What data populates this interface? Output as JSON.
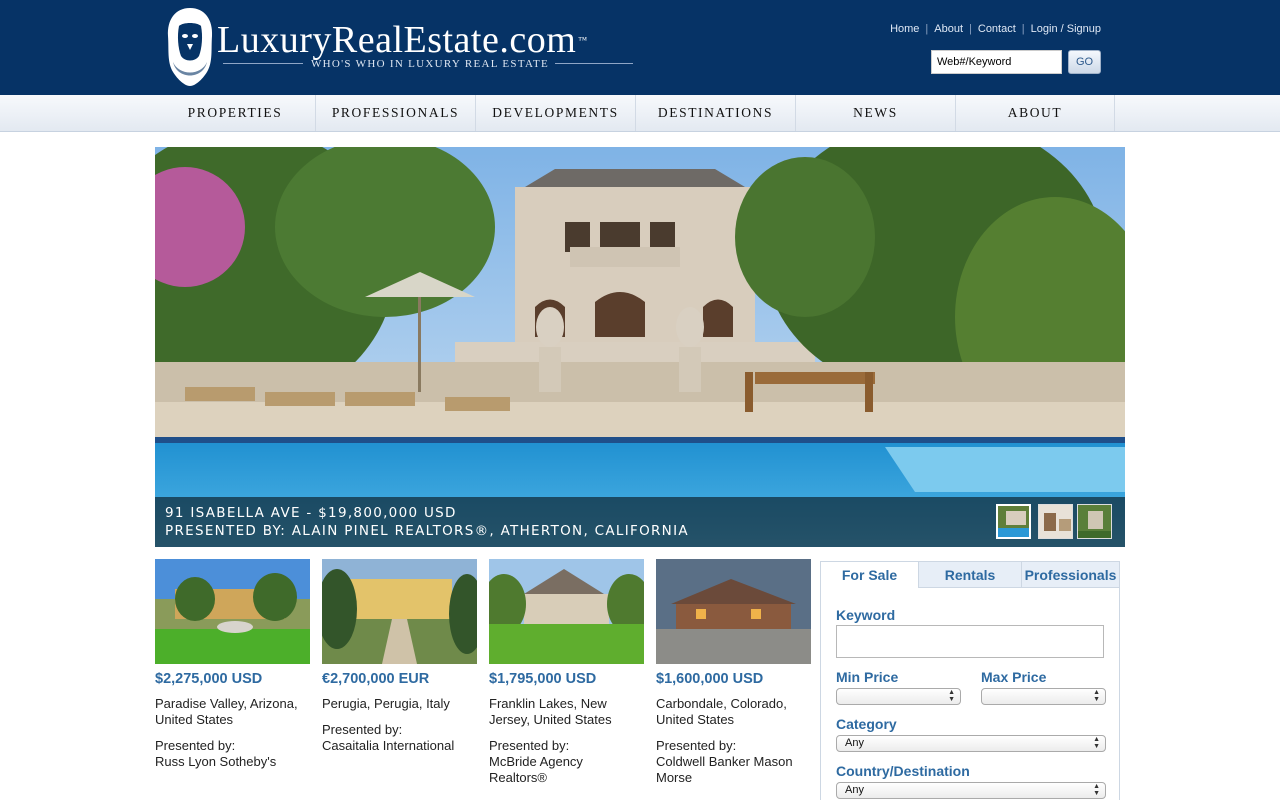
{
  "header": {
    "brand_title": "LuxuryRealEstate.com",
    "trademark": "™",
    "tagline": "WHO'S WHO IN LUXURY REAL ESTATE",
    "top_links": [
      {
        "label": "Home"
      },
      {
        "label": "About"
      },
      {
        "label": "Contact"
      },
      {
        "label": "Login / Signup"
      }
    ],
    "search_value": "Web#/Keyword",
    "go_label": "GO"
  },
  "nav": {
    "items": [
      {
        "label": "PROPERTIES"
      },
      {
        "label": "PROFESSIONALS"
      },
      {
        "label": "DEVELOPMENTS"
      },
      {
        "label": "DESTINATIONS"
      },
      {
        "label": "NEWS"
      },
      {
        "label": "ABOUT"
      }
    ]
  },
  "hero": {
    "line1": "91 ISABELLA AVE - $19,800,000 USD",
    "line2": "PRESENTED BY: ALAIN PINEL REALTORS®, ATHERTON, CALIFORNIA",
    "thumbnails_count": 3,
    "active_thumbnail": 1
  },
  "listings": [
    {
      "price": "$2,275,000 USD",
      "location": "Paradise Valley, Arizona, United States",
      "presented_label": "Presented by:",
      "presented_by": "Russ Lyon Sotheby's"
    },
    {
      "price": "€2,700,000 EUR",
      "location": "Perugia, Perugia, Italy",
      "presented_label": "Presented by:",
      "presented_by": "Casaitalia International"
    },
    {
      "price": "$1,795,000 USD",
      "location": "Franklin Lakes, New Jersey, United States",
      "presented_label": "Presented by:",
      "presented_by": "McBride Agency Realtors®"
    },
    {
      "price": "$1,600,000 USD",
      "location": "Carbondale, Colorado, United States",
      "presented_label": "Presented by:",
      "presented_by": "Coldwell Banker Mason Morse"
    }
  ],
  "search_panel": {
    "tabs": [
      {
        "label": "For Sale"
      },
      {
        "label": "Rentals"
      },
      {
        "label": "Professionals"
      }
    ],
    "active_tab": "For Sale",
    "keyword_label": "Keyword",
    "keyword_value": "",
    "min_price_label": "Min Price",
    "min_price_value": "",
    "max_price_label": "Max Price",
    "max_price_value": "",
    "category_label": "Category",
    "category_value": "Any",
    "country_label": "Country/Destination",
    "country_value": "Any"
  },
  "colors": {
    "header_bg": "#063366",
    "link_blue": "#2e6aa1",
    "nav_bg": "#eef2f7"
  }
}
